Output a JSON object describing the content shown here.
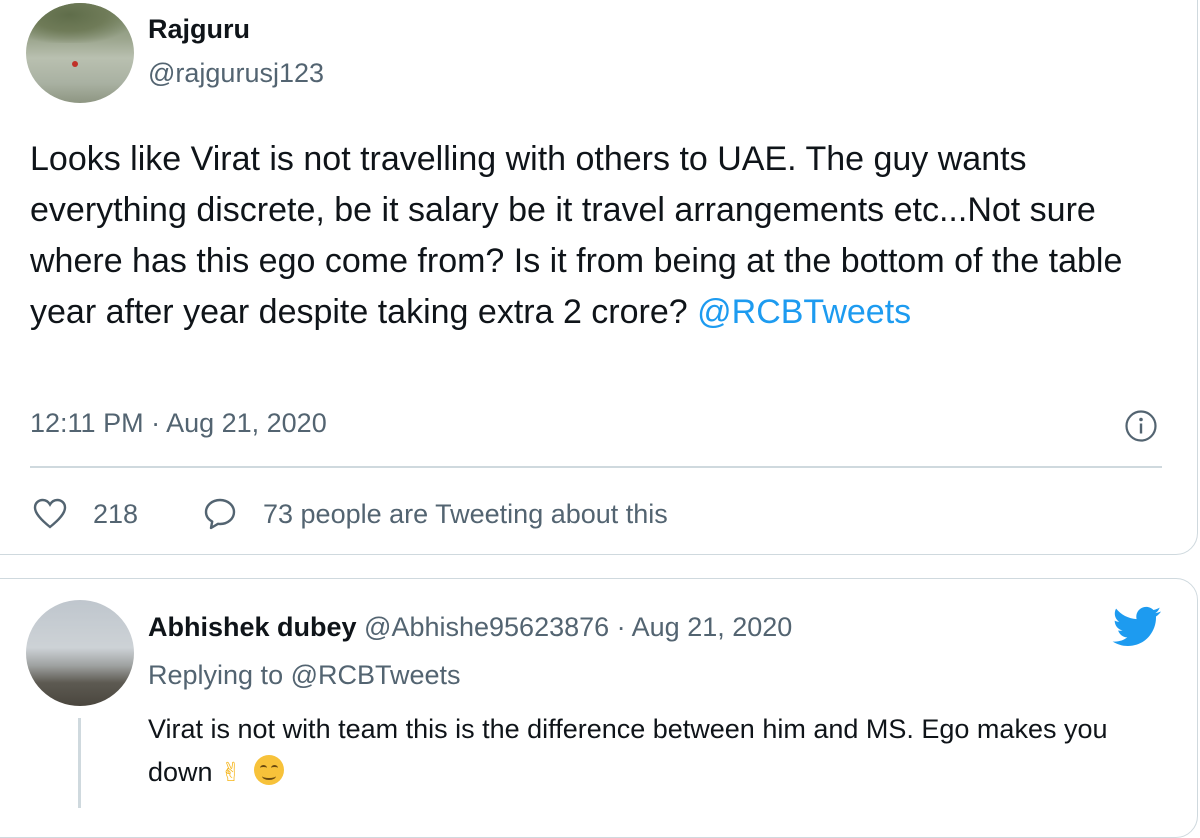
{
  "main_tweet": {
    "author_name": "Rajguru",
    "handle": "@rajgurusj123",
    "text": "Looks like Virat is not travelling with others to UAE. The guy wants everything discrete, be it salary be it travel arrangements etc...Not sure where has this ego come from? Is it from being at the bottom of the table year after year despite taking extra 2 crore? ",
    "mention": "@RCBTweets",
    "timestamp": "12:11 PM · Aug 21, 2020",
    "like_count": "218",
    "tweeting_text": "73 people are Tweeting about this"
  },
  "reply_tweet": {
    "author_name": "Abhishek dubey",
    "meta": " @Abhishe95623876 · Aug 21, 2020",
    "replying_to": "Replying to @RCBTweets",
    "text": "Virat is not with team this is the difference between him and MS. Ego makes you down ",
    "emoji_1": "✌",
    "emoji_2": "smiling-face-with-smiling-eyes"
  },
  "icons": {
    "info": "info-icon",
    "like": "heart-icon",
    "reply": "speech-bubble-icon",
    "brand": "twitter-bird-icon"
  },
  "colors": {
    "link": "#1d9bf0",
    "secondary_text": "#536471",
    "primary_text": "#0f1419",
    "border": "#cfd9de"
  }
}
